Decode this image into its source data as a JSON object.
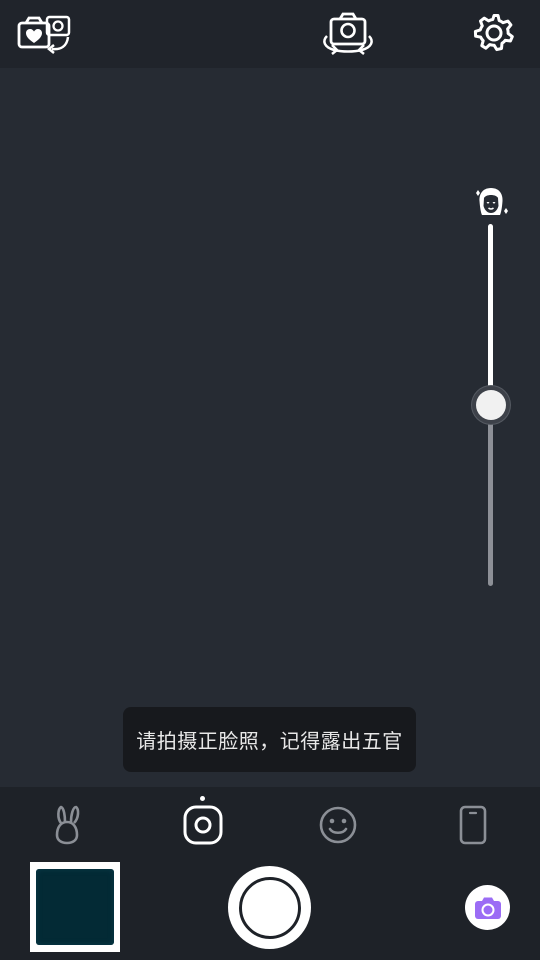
{
  "toast": {
    "message": "请拍摄正脸照，记得露出五官"
  },
  "top_bar": {
    "icons": [
      "beauty-camera-switch-icon",
      "flip-camera-icon",
      "settings-icon"
    ]
  },
  "beauty_slider": {
    "icon": "face-beauty-icon",
    "level": 0.5
  },
  "modes": [
    {
      "name": "bunny-sticker-icon",
      "selected": false
    },
    {
      "name": "camera-lens-icon",
      "selected": true
    },
    {
      "name": "smile-face-icon",
      "selected": false
    },
    {
      "name": "phone-frame-icon",
      "selected": false
    }
  ],
  "bottom": {
    "gallery_thumbnail": "gallery-thumbnail",
    "shutter": "shutter-button",
    "mini_camera_icon": "purple-camera-icon"
  },
  "colors": {
    "background": "#262b33",
    "top_bar": "#20242b",
    "bottom_panel": "#1e2228",
    "toast_bg": "#17191d",
    "accent_purple": "#9b6cf5",
    "thumbnail": "#032a35"
  }
}
